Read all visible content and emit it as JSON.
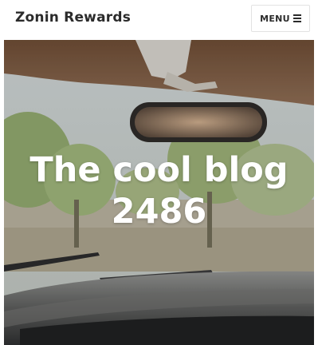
{
  "header": {
    "site_title": "Zonin Rewards",
    "menu_label": "MENU",
    "menu_icon": "hamburger-icon"
  },
  "hero": {
    "title": "The cool blog 2486",
    "background": "car-interior-photo"
  }
}
